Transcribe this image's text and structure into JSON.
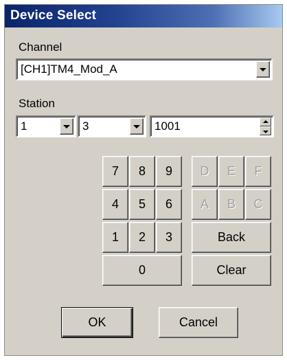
{
  "window": {
    "title": "Device Select"
  },
  "channel": {
    "label": "Channel",
    "value": "[CH1]TM4_Mod_A"
  },
  "station": {
    "label": "Station",
    "first": "1",
    "second": "3",
    "number": "1001"
  },
  "keypad": {
    "row1": [
      "7",
      "8",
      "9",
      "D",
      "E",
      "F"
    ],
    "row2": [
      "4",
      "5",
      "6",
      "A",
      "B",
      "C"
    ],
    "row3": [
      "1",
      "2",
      "3"
    ],
    "back": "Back",
    "zero": "0",
    "clear": "Clear"
  },
  "buttons": {
    "ok": "OK",
    "cancel": "Cancel"
  },
  "colors": {
    "title_start": "#0a246a",
    "title_end": "#a6caf0",
    "face": "#d4d0c8"
  }
}
